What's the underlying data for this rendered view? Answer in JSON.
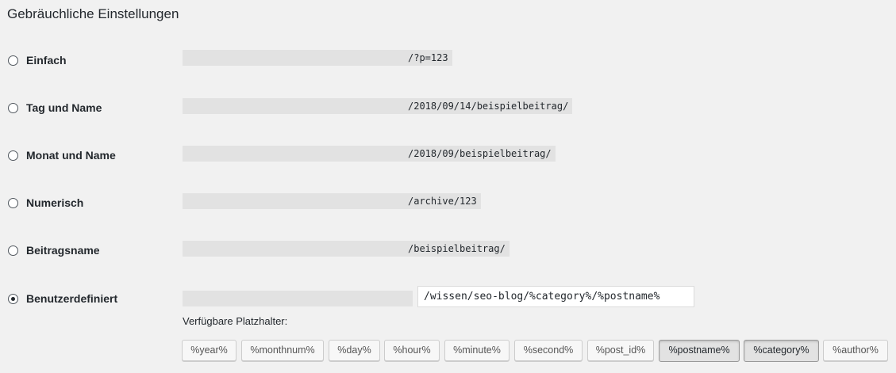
{
  "section_title": "Gebräuchliche Einstellungen",
  "options": [
    {
      "label": "Einfach",
      "path": "/?p=123",
      "checked": false
    },
    {
      "label": "Tag und Name",
      "path": "/2018/09/14/beispielbeitrag/",
      "checked": false
    },
    {
      "label": "Monat und Name",
      "path": "/2018/09/beispielbeitrag/",
      "checked": false
    },
    {
      "label": "Numerisch",
      "path": "/archive/123",
      "checked": false
    },
    {
      "label": "Beitragsname",
      "path": "/beispielbeitrag/",
      "checked": false
    },
    {
      "label": "Benutzerdefiniert",
      "checked": true,
      "custom_value": "/wissen/seo-blog/%category%/%postname%"
    }
  ],
  "placeholders": {
    "label": "Verfügbare Platzhalter:",
    "tags": [
      {
        "label": "%year%",
        "active": false
      },
      {
        "label": "%monthnum%",
        "active": false
      },
      {
        "label": "%day%",
        "active": false
      },
      {
        "label": "%hour%",
        "active": false
      },
      {
        "label": "%minute%",
        "active": false
      },
      {
        "label": "%second%",
        "active": false
      },
      {
        "label": "%post_id%",
        "active": false
      },
      {
        "label": "%postname%",
        "active": true
      },
      {
        "label": "%category%",
        "active": true
      },
      {
        "label": "%author%",
        "active": false
      }
    ]
  }
}
